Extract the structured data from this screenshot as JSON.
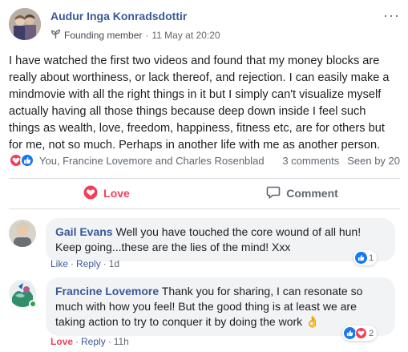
{
  "post": {
    "author": "Audur Inga Konradsdottir",
    "badge": "Founding member",
    "separator": "·",
    "time": "11 May at 20:20",
    "text": "I have watched the first two videos and found that my money blocks are really about worthiness, or lack thereof, and rejection. I can easily make a mindmovie with all the right things in it but I simply can't visualize myself actually having all those things because deep down inside I feel such things as wealth, love, freedom, happiness, fitness etc, are for others but for me, not so much. Perhaps in another life with me as another person.",
    "more_glyph": "···"
  },
  "reactions": {
    "names": "You, Francine Lovemore and Charles Rosenblad",
    "comments": "3 comments",
    "seen": "Seen by 20"
  },
  "actions": {
    "love": "Love",
    "comment": "Comment"
  },
  "comments": [
    {
      "name": "Gail Evans",
      "text": "Well you have touched the core wound of all hun! Keep going...these are the lies of the mind! Xxx",
      "like": "Like",
      "reply": "Reply",
      "time": "1d",
      "reaction_count": "1"
    },
    {
      "name": "Francine Lovemore",
      "text": "Thank you for sharing, I can resonate so much with how you feel! But the good thing is at least we are taking action to try to conquer it by doing the work",
      "emoji": "👌",
      "like": "Love",
      "reply": "Reply",
      "time": "11h",
      "reaction_count": "2"
    }
  ],
  "colors": {
    "link": "#385898",
    "love": "#f33e58",
    "like": "#1877f2",
    "bubble": "#f2f3f5"
  }
}
